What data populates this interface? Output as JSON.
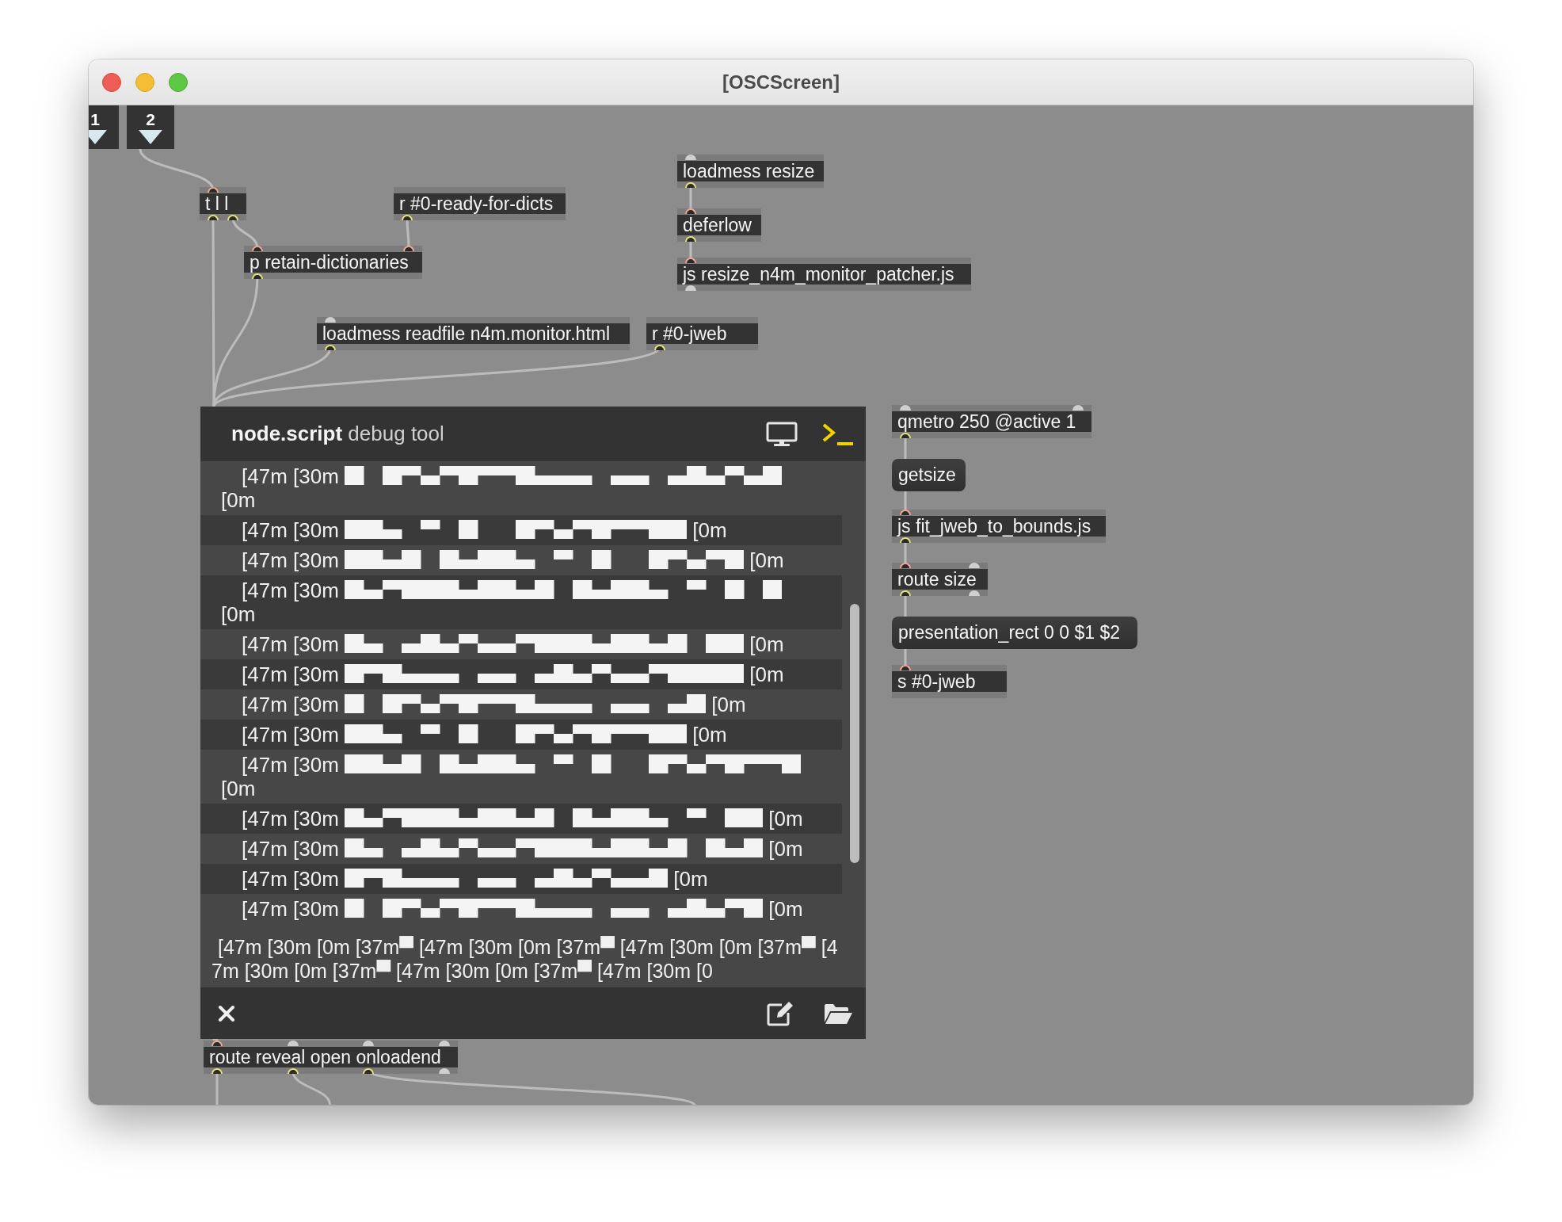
{
  "window": {
    "title": "[OSCScreen]"
  },
  "patcher": {
    "nodes": [
      {
        "kind": "inlet",
        "label": "1"
      },
      {
        "kind": "inlet",
        "label": "2"
      },
      {
        "kind": "object",
        "text": "t l l",
        "inlets": [
          true
        ],
        "outlets": [
          true,
          true
        ]
      },
      {
        "kind": "object",
        "text": "r #0-ready-for-dicts",
        "outlets": [
          true
        ]
      },
      {
        "kind": "object",
        "text": "p retain-dictionaries",
        "inlets": [
          true,
          true
        ],
        "outlets": [
          true
        ]
      },
      {
        "kind": "object",
        "text": "loadmess resize",
        "inlets": [
          false
        ],
        "outlets": [
          true
        ]
      },
      {
        "kind": "object",
        "text": "deferlow",
        "inlets": [
          true
        ],
        "outlets": [
          true
        ]
      },
      {
        "kind": "object",
        "text": "js resize_n4m_monitor_patcher.js",
        "inlets": [
          true
        ],
        "outlets": [
          false
        ]
      },
      {
        "kind": "object",
        "text": "loadmess readfile n4m.monitor.html",
        "inlets": [
          false
        ],
        "outlets": [
          true
        ]
      },
      {
        "kind": "object",
        "text": "r #0-jweb",
        "outlets": [
          true
        ]
      },
      {
        "kind": "jweb",
        "title": "**node.script** debug tool",
        "log": [
          {
            "lead": "[47m [30m",
            "tail": "[0m"
          },
          {
            "lead": "[47m [30m",
            "tail": "[0m"
          },
          {
            "lead": "[47m [30m",
            "tail": "[0m"
          },
          {
            "lead": "[47m [30m",
            "tail": "[0m"
          },
          {
            "lead": "[47m [30m",
            "tail": "[0m"
          },
          {
            "lead": "[47m [30m",
            "tail": "[0m"
          },
          {
            "lead": "[47m [30m",
            "tail": "[0m"
          },
          {
            "lead": "[47m [30m",
            "tail": "[0m"
          },
          {
            "lead": "[47m [30m",
            "tail": "[0m"
          },
          {
            "lead": "[47m [30m",
            "tail": "[0m"
          },
          {
            "lead": "[47m [30m",
            "tail": "[0m"
          },
          {
            "lead": "[47m [30m",
            "tail": "[0m"
          },
          {
            "lead": "[47m [30m",
            "tail": "[0m"
          }
        ],
        "last_line": "[47m [30m [0m [37m▀ [47m [30m [0m [37m▀ [47m [30m [0m [37m▀ [47m [30m [0m [37m▀ [47m [30m [0m [37m▀ [47m [30m [0"
      },
      {
        "kind": "object",
        "text": "qmetro 250 @active 1",
        "inlets": [
          false,
          false
        ],
        "outlets": [
          true
        ]
      },
      {
        "kind": "message",
        "text": "getsize"
      },
      {
        "kind": "object",
        "text": "js fit_jweb_to_bounds.js",
        "inlets": [
          true
        ],
        "outlets": [
          true
        ]
      },
      {
        "kind": "object",
        "text": "route size",
        "inlets": [
          true,
          false
        ],
        "outlets": [
          true,
          false
        ]
      },
      {
        "kind": "message",
        "text": "presentation_rect 0 0 $1 $2"
      },
      {
        "kind": "object",
        "text": "s #0-jweb",
        "inlets": [
          true
        ]
      },
      {
        "kind": "object",
        "text": "route reveal open onloadend",
        "inlets": [
          true,
          false,
          false,
          false
        ],
        "outlets": [
          true,
          true,
          true,
          false
        ]
      }
    ]
  }
}
